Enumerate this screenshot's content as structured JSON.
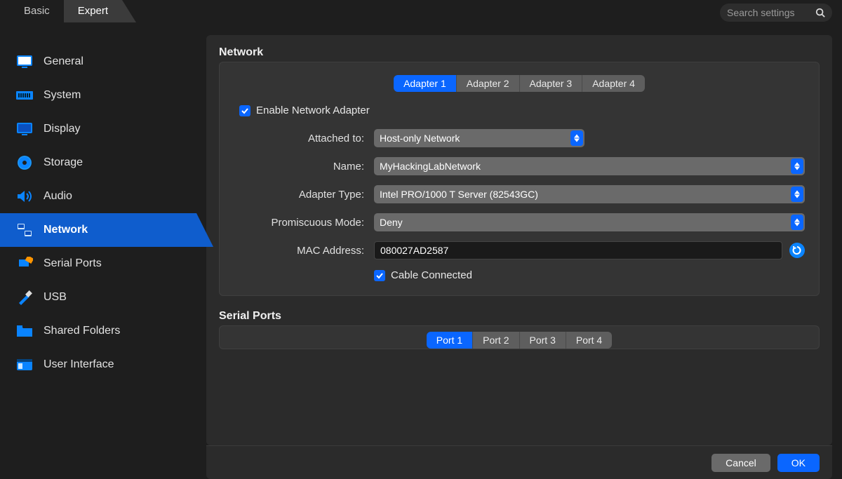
{
  "modeTabs": {
    "basic": "Basic",
    "expert": "Expert",
    "active": "expert"
  },
  "search": {
    "placeholder": "Search settings"
  },
  "sidebar": {
    "items": [
      {
        "label": "General",
        "icon": "general"
      },
      {
        "label": "System",
        "icon": "system"
      },
      {
        "label": "Display",
        "icon": "display"
      },
      {
        "label": "Storage",
        "icon": "storage"
      },
      {
        "label": "Audio",
        "icon": "audio"
      },
      {
        "label": "Network",
        "icon": "network"
      },
      {
        "label": "Serial Ports",
        "icon": "serial"
      },
      {
        "label": "USB",
        "icon": "usb"
      },
      {
        "label": "Shared Folders",
        "icon": "folders"
      },
      {
        "label": "User Interface",
        "icon": "ui"
      }
    ],
    "selectedIndex": 5
  },
  "network": {
    "title": "Network",
    "tabs": [
      "Adapter 1",
      "Adapter 2",
      "Adapter 3",
      "Adapter 4"
    ],
    "activeTab": 0,
    "enableLabel": "Enable Network Adapter",
    "enableChecked": true,
    "fields": {
      "attachedTo": {
        "label": "Attached to:",
        "value": "Host-only Network"
      },
      "name": {
        "label": "Name:",
        "value": "MyHackingLabNetwork"
      },
      "adapterType": {
        "label": "Adapter Type:",
        "value": "Intel PRO/1000 T Server (82543GC)"
      },
      "promiscuous": {
        "label": "Promiscuous Mode:",
        "value": "Deny"
      },
      "mac": {
        "label": "MAC Address:",
        "value": "080027AD2587"
      }
    },
    "cableLabel": "Cable Connected",
    "cableChecked": true
  },
  "serial": {
    "title": "Serial Ports",
    "tabs": [
      "Port 1",
      "Port 2",
      "Port 3",
      "Port 4"
    ],
    "activeTab": 0
  },
  "footer": {
    "cancel": "Cancel",
    "ok": "OK"
  }
}
